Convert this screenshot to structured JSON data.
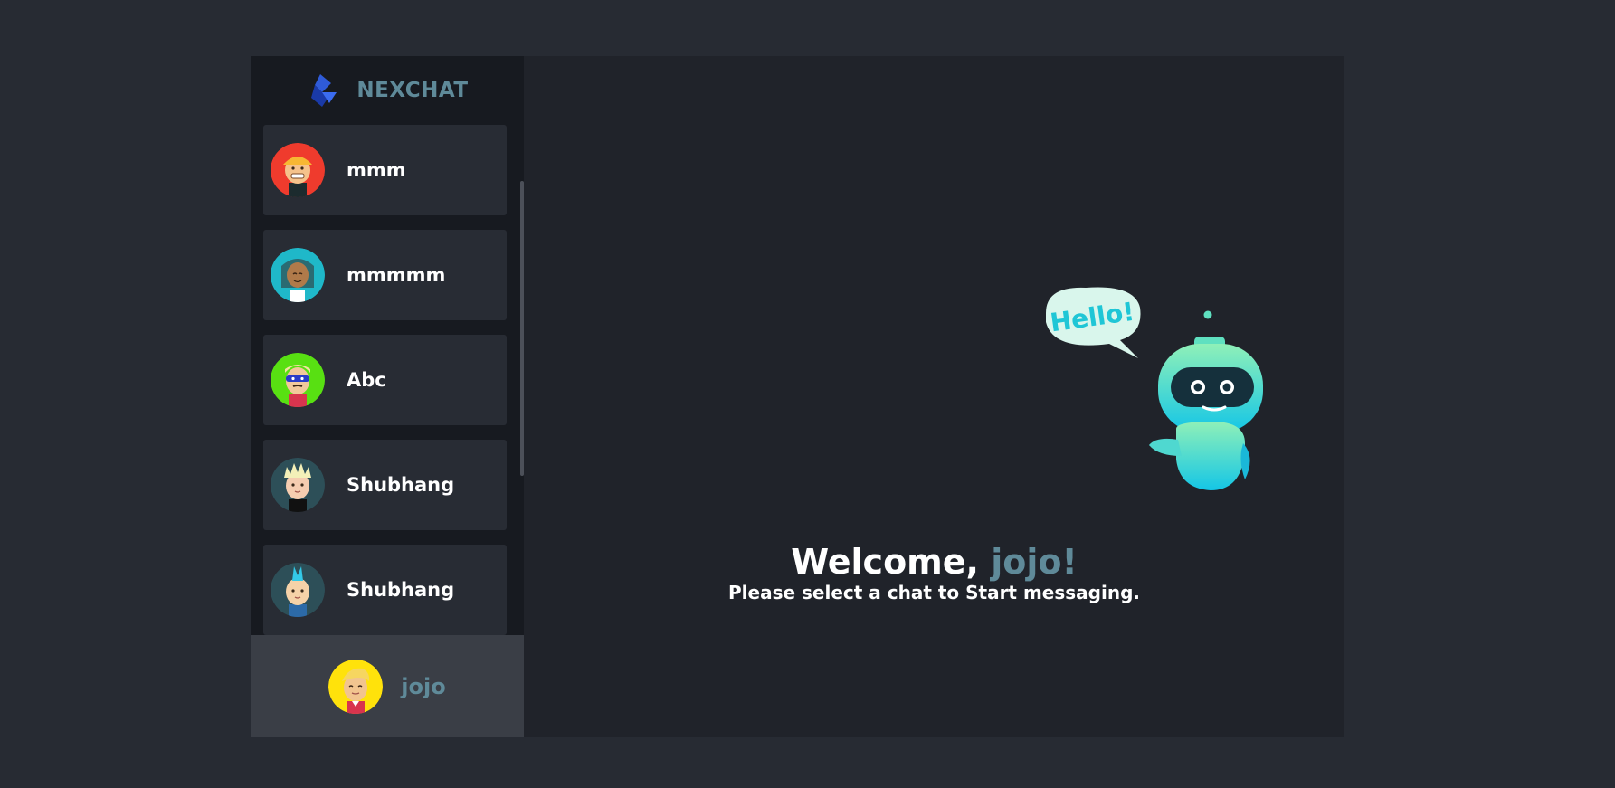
{
  "brand": {
    "name": "NEXCHAT",
    "logo_icon": "nexchat-logo-icon"
  },
  "contacts": [
    {
      "name": "mmm",
      "avatar_bg": "#ef3b2d",
      "hair": "#f7b733",
      "skin": "#f5c28b",
      "avatar_icon": "hardhat-avatar-icon"
    },
    {
      "name": "mmmmm",
      "avatar_bg": "#1fb8c9",
      "hair": "#2a6b73",
      "skin": "#b07a4a",
      "avatar_icon": "dreadlocks-avatar-icon"
    },
    {
      "name": "Abc",
      "avatar_bg": "#58e012",
      "hair": "#f3e3a0",
      "skin": "#f2c89b",
      "avatar_icon": "masked-avatar-icon"
    },
    {
      "name": "Shubhang",
      "avatar_bg": "#2d4f58",
      "hair": "#f3f0b8",
      "skin": "#f5cdb0",
      "avatar_icon": "spiky-hair-avatar-icon"
    },
    {
      "name": "Shubhang",
      "avatar_bg": "#2d4f58",
      "hair": "#33c9e8",
      "skin": "#f5d2a8",
      "avatar_icon": "mohawk-avatar-icon"
    }
  ],
  "current_user": {
    "name": "jojo",
    "avatar_bg": "#ffe20b",
    "avatar_icon": "blond-avatar-icon"
  },
  "welcome": {
    "greeting": "Welcome, ",
    "username": "jojo!",
    "subtitle": "Please select a chat to Start messaging."
  },
  "robot": {
    "bubble_text": "Hello!"
  },
  "colors": {
    "page_bg": "#272b33",
    "sidebar_bg": "#171a20",
    "card_bg": "#282c34",
    "main_bg": "#20232a",
    "accent": "#5f8a99",
    "footer_bg": "#3a3e46"
  }
}
